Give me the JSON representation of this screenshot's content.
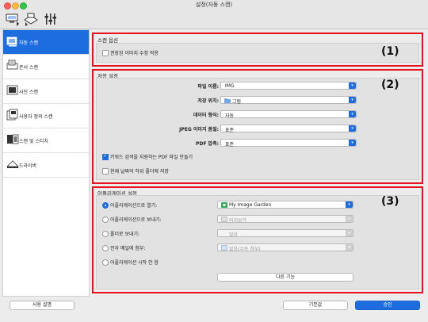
{
  "window": {
    "title": "설정(자동 스캔)"
  },
  "colors": {
    "accent": "#1d6de0",
    "highlight_box": "#e8101c"
  },
  "toolbar": {
    "icons": [
      "scan-from-computer-icon",
      "scan-from-operation-panel-icon",
      "general-settings-icon"
    ]
  },
  "sidebar": {
    "items": [
      {
        "label": "자동 스캔",
        "icon": "auto-scan-icon",
        "active": true
      },
      {
        "label": "문서 스캔",
        "icon": "document-scan-icon"
      },
      {
        "label": "사진 스캔",
        "icon": "photo-scan-icon"
      },
      {
        "label": "사용자 정의 스캔",
        "icon": "custom-scan-icon"
      },
      {
        "label": "스캔 및 스티치",
        "icon": "scan-stitch-icon"
      },
      {
        "label": "드라이버",
        "icon": "driver-icon"
      }
    ]
  },
  "scan_options": {
    "title": "스캔 옵션",
    "marker": "(1)",
    "apply_correction_label": "권장된 이미지 수정 적용",
    "apply_correction_checked": false
  },
  "save_settings": {
    "title": "저장 설정",
    "marker": "(2)",
    "file_name_label": "파일 이름:",
    "file_name_value": "IMG",
    "save_in_label": "저장 위치:",
    "save_in_value": "그림",
    "data_format_label": "데이터 형식:",
    "data_format_value": "자동",
    "jpeg_quality_label": "JPEG 이미지 품질:",
    "jpeg_quality_value": "표준",
    "pdf_compression_label": "PDF 압축:",
    "pdf_compression_value": "표준",
    "keyword_pdf_label": "키워드 검색을 지원하는 PDF 파일 만들기",
    "keyword_pdf_checked": true,
    "subfolder_label": "현재 날짜의 하위 폴더에 저장",
    "subfolder_checked": false
  },
  "app_settings": {
    "title": "어플리케이션 설정",
    "marker": "(3)",
    "open_with_label": "어플리케이션으로 열기:",
    "open_with_value": "My Image Garden",
    "send_to_app_label": "어플리케이션으로 보내기:",
    "send_to_app_value": "미리보기",
    "send_to_folder_label": "폴더로 보내기:",
    "send_to_folder_value": "없음",
    "attach_email_label": "전자 메일에 첨부:",
    "attach_email_value": "없음(수동 첨부)",
    "no_app_label": "어플리케이션 시작 안 함",
    "more_functions_label": "다른 기능"
  },
  "footer": {
    "instructions_label": "사용 설명",
    "defaults_label": "기본값",
    "ok_label": "승인"
  }
}
